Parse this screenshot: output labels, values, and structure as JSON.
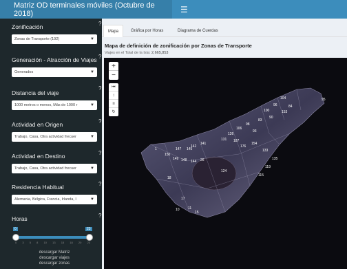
{
  "header": {
    "title": "Matriz OD terminales móviles (Octubre de 2018)",
    "menu_icon": "hamburger-icon"
  },
  "sidebar": {
    "controls": [
      {
        "label": "Zonificación",
        "value": "Zonas de Transporte (192)"
      },
      {
        "label": "Generación - Atracción de Viajes",
        "value": "Generados"
      },
      {
        "label": "Distancia del viaje",
        "value": "1000 metros o menos, Más de 1000 r"
      },
      {
        "label": "Actividad en Origen",
        "value": "Trabajo, Casa, Otra actividad frecuer"
      },
      {
        "label": "Actividad en Destino",
        "value": "Trabajo, Casa, Otra actividad frecuer"
      },
      {
        "label": "Residencia Habitual",
        "value": "Alemania, Bélgica, Francia, Irlanda, I"
      }
    ],
    "help_mark": "?",
    "hours": {
      "label": "Horas",
      "min": "0",
      "max": "23",
      "ticks": [
        "0",
        "3",
        "5",
        "8",
        "10",
        "13",
        "15",
        "18",
        "20",
        "23"
      ]
    },
    "downloads": [
      "descargar Matriz",
      "descargar viajes",
      "descargar zonas"
    ]
  },
  "tabs": [
    "Mapa",
    "Gráfica por Horas",
    "Diagrama de Cuerdas"
  ],
  "map": {
    "title": "Mapa de definición de zonificación por  Zonas de Transporte",
    "subtitle_label": "Viajes en el Total de la Isla:",
    "subtitle_value": "2,665,853",
    "zoom_in": "+",
    "zoom_out": "−",
    "labels": [
      "104",
      "95",
      "84",
      "96",
      "100",
      "153",
      "90",
      "83",
      "98",
      "106",
      "93",
      "126",
      "131",
      "187",
      "176",
      "154",
      "133",
      "135",
      "119",
      "115",
      "141",
      "142",
      "147",
      "145",
      "1",
      "150",
      "148",
      "149",
      "144",
      "26",
      "124",
      "18",
      "11",
      "17",
      "15",
      "10"
    ]
  }
}
